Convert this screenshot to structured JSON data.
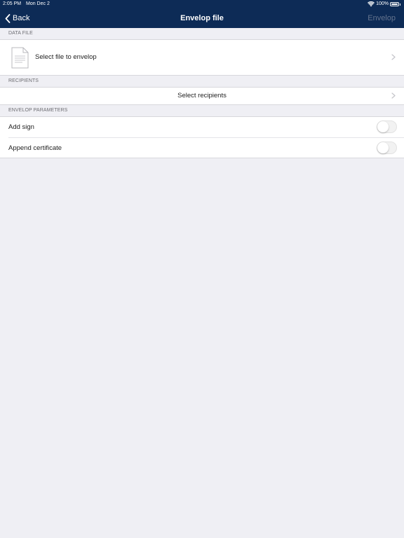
{
  "status_bar": {
    "time": "2:05 PM",
    "date": "Mon Dec 2",
    "battery": "100%"
  },
  "nav": {
    "back_label": "Back",
    "title": "Envelop file",
    "action_label": "Envelop"
  },
  "sections": {
    "data_file": {
      "header": "DATA FILE",
      "row_label": "Select file to envelop"
    },
    "recipients": {
      "header": "RECIPIENTS",
      "row_label": "Select recipients"
    },
    "parameters": {
      "header": "ENVELOP PARAMETERS",
      "rows": [
        {
          "label": "Add sign",
          "enabled": false
        },
        {
          "label": "Append certificate",
          "enabled": false
        }
      ]
    }
  },
  "icons": {
    "back": "chevron-left-icon",
    "disclosure": "chevron-right-icon",
    "file": "document-icon",
    "wifi": "wifi-icon",
    "battery": "battery-icon"
  },
  "colors": {
    "nav_background": "#0d2b56",
    "page_background": "#efeff4",
    "disabled_action": "#65748e"
  }
}
